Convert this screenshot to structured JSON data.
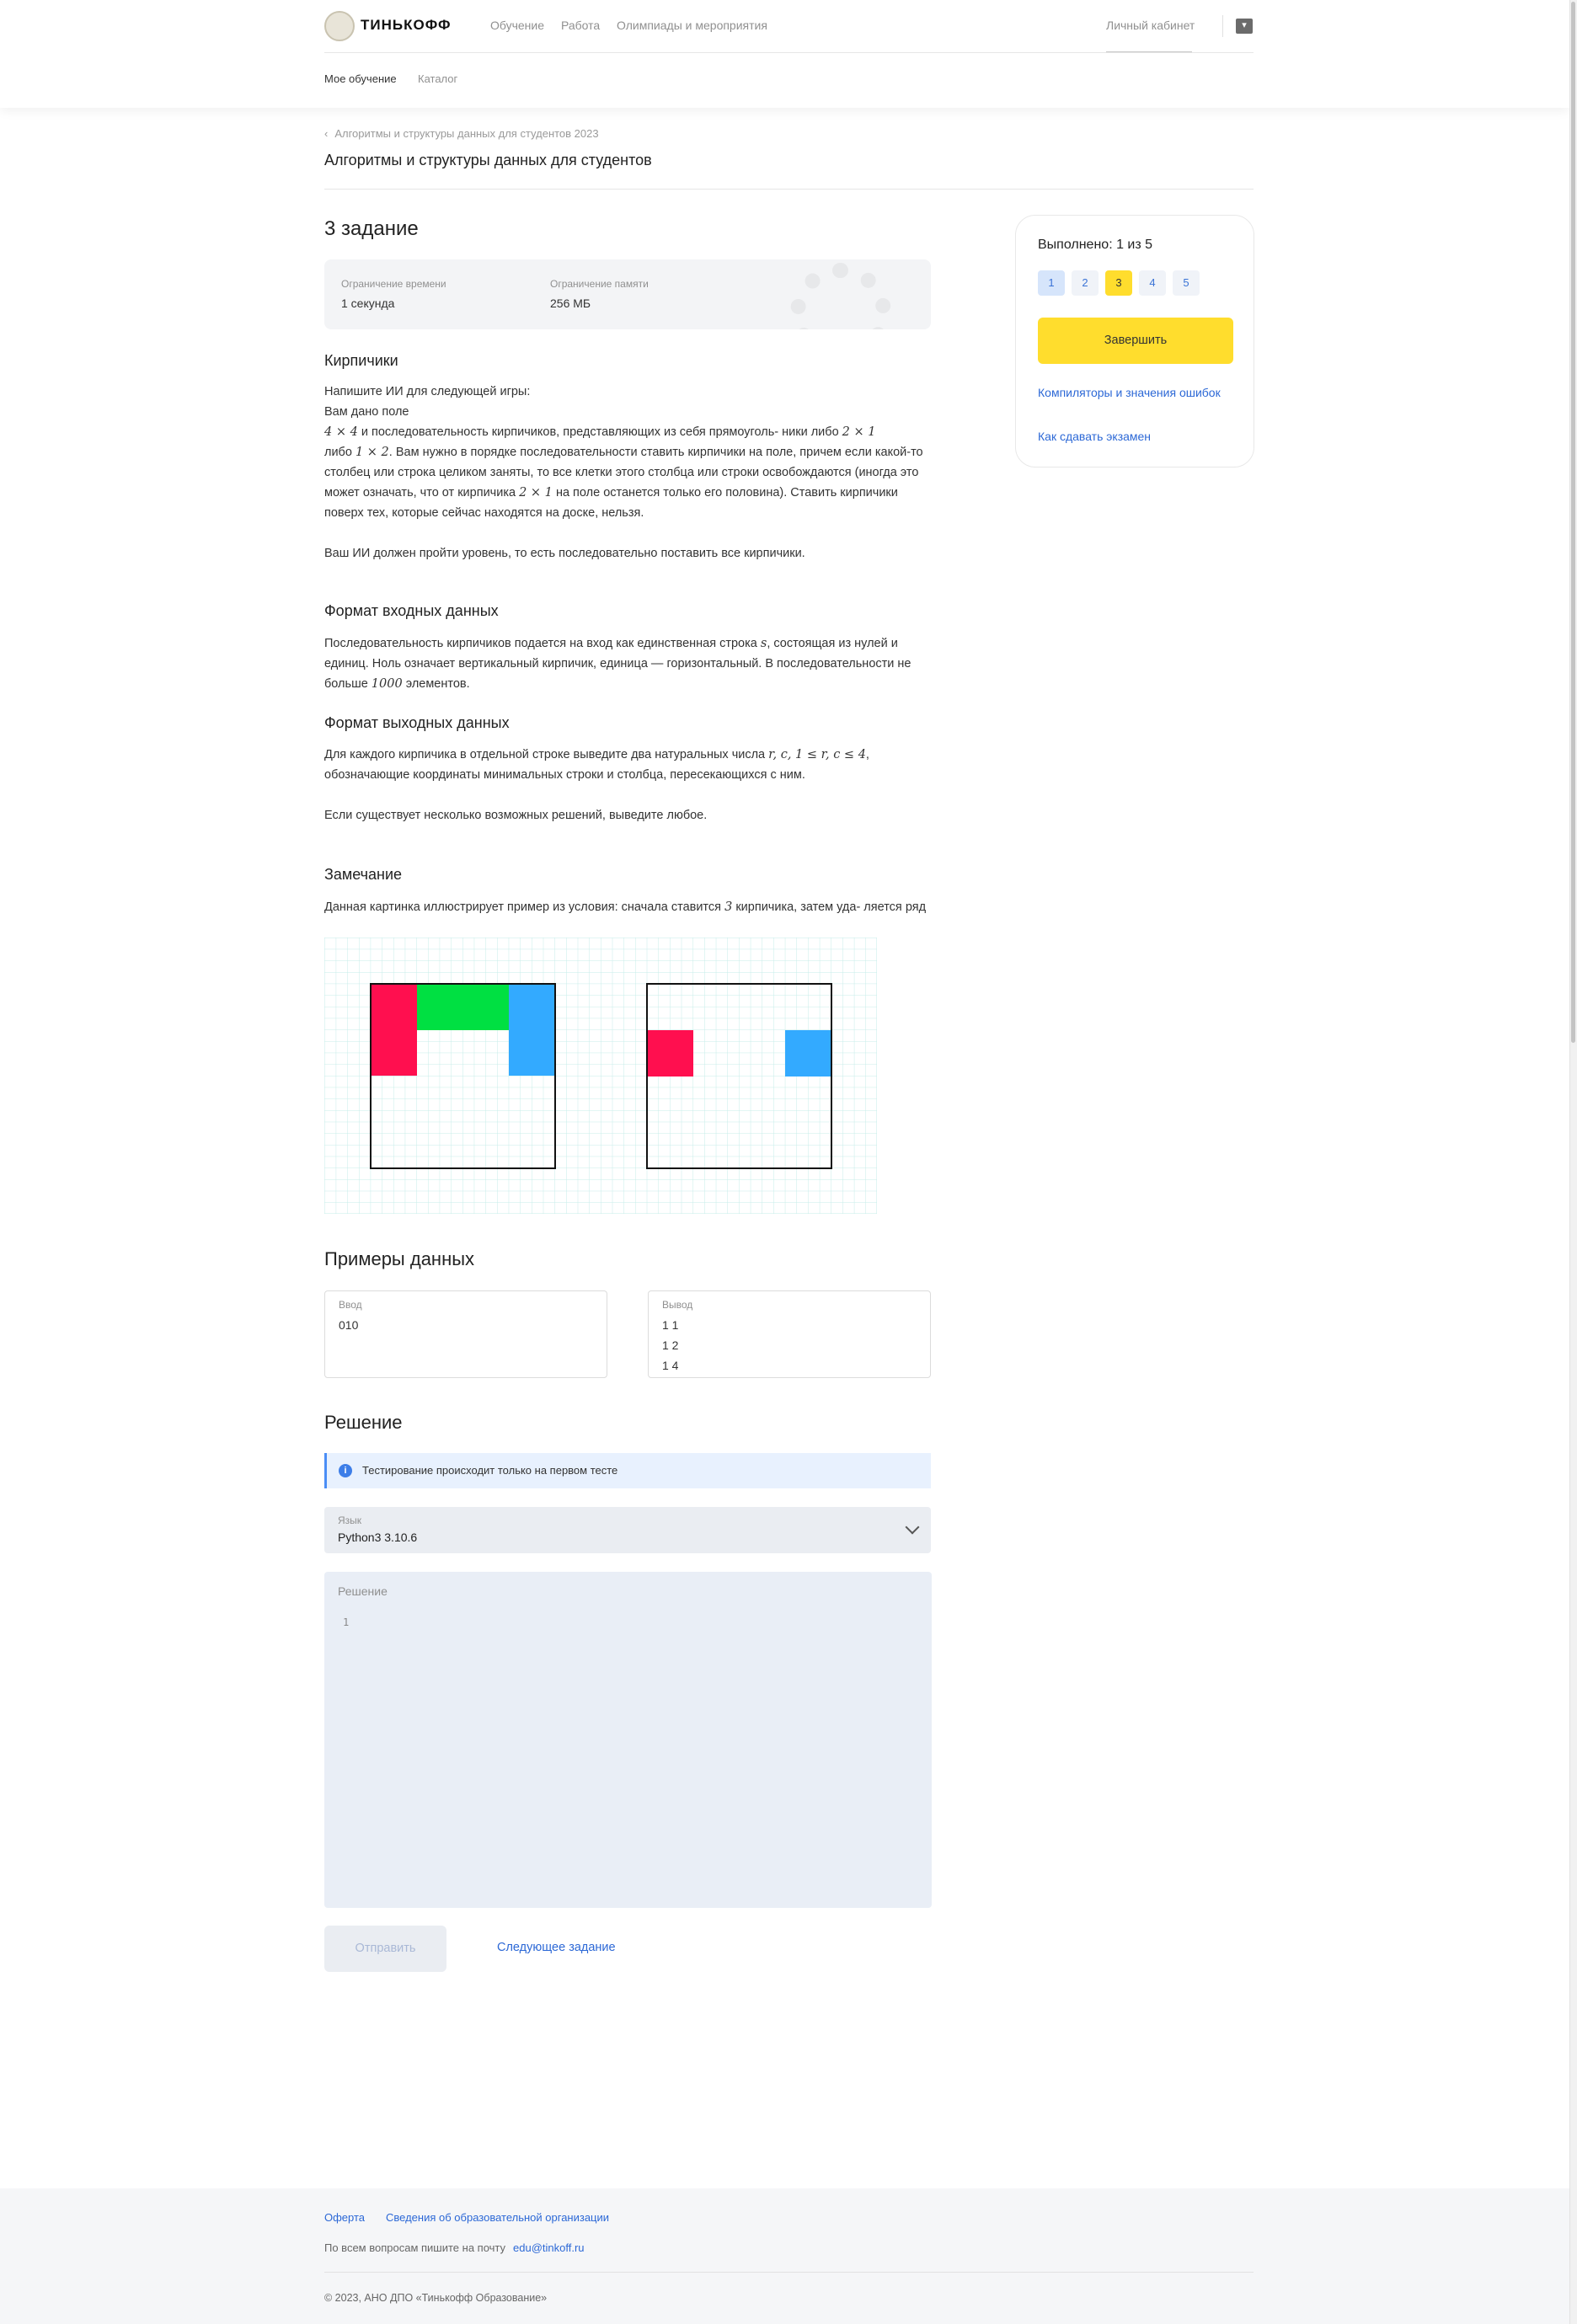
{
  "header": {
    "logo_text": "ТИНЬКОФФ",
    "nav": [
      "Обучение",
      "Работа",
      "Олимпиады и мероприятия"
    ],
    "cabinet": "Личный кабинет",
    "subnav": [
      "Мое обучение",
      "Каталог"
    ]
  },
  "breadcrumb": "Алгоритмы и структуры данных для студентов 2023",
  "course_title": "Алгоритмы и структуры данных для студентов",
  "task": {
    "title": "3 задание",
    "time_label": "Ограничение времени",
    "time_value": "1 секунда",
    "memory_label": "Ограничение памяти",
    "memory_value": "256 МБ",
    "name": "Кирпичики",
    "statement": [
      "Напишите ИИ для следующей игры:",
      "Вам дано поле",
      "и последовательность кирпичиков, представляющих из себя прямоуголь- ники либо",
      "либо",
      ". Вам нужно в порядке последовательности ставить кирпичики на поле, причем если какой-то столбец или строка целиком заняты, то все клетки этого столбца или строки освобождаются (иногда это может означать, что от кирпичика",
      "на поле останется только его половина). Ставить кирпичики поверх тех, которые сейчас находятся на доске, нельзя.",
      "Ваш ИИ должен пройти уровень, то есть последовательно поставить все кирпичики."
    ],
    "math": {
      "m4x4": "4 × 4",
      "m2x1": "2 × 1",
      "m1x2": "1 × 2"
    },
    "input_title": "Формат входных данных",
    "input_text": [
      "Последовательность кирпичиков подается на вход как единственная строка",
      ", состоящая из нулей и единиц. Ноль означает вертикальный кирпичик, единица — горизонтальный. В последовательности не больше",
      "элементов."
    ],
    "input_math": [
      "s",
      "1000"
    ],
    "output_title": "Формат выходных данных",
    "output_text": [
      "Для каждого кирпичика в отдельной строке выведите два натуральных числа",
      ", обозначающие координаты минимальных строки и столбца, пересекающихся с ним.",
      "Если существует несколько возможных решений, выведите любое."
    ],
    "output_math": "r, c, 1 ≤ r, c ≤ 4",
    "note_title": "Замечание",
    "note_text": [
      "Данная картинка иллюстрирует пример из условия: сначала ставится",
      "кирпичика, затем уда- ляется ряд"
    ],
    "note_math": "3"
  },
  "figure": {
    "colors": {
      "red": "#ff0f4f",
      "green": "#00e042",
      "blue": "#33aaff",
      "grid": "#c6ece9"
    }
  },
  "examples": {
    "title": "Примеры данных",
    "input_label": "Ввод",
    "input_lines": [
      "010"
    ],
    "output_label": "Вывод",
    "output_lines": [
      "1 1",
      "1 2",
      "1 4"
    ]
  },
  "solution": {
    "title": "Решение",
    "info": "Тестирование происходит только на первом тесте",
    "lang_label": "Язык",
    "lang_value": "Python3 3.10.6",
    "editor_label": "Решение",
    "line_number": "1",
    "send": "Отправить",
    "next": "Следующее задание"
  },
  "card": {
    "progress": "Выполнено: 1 из 5",
    "tasks": [
      "1",
      "2",
      "3",
      "4",
      "5"
    ],
    "finish": "Завершить",
    "link1": "Компиляторы и значения ошибок",
    "link2": "Как сдавать экзамен"
  },
  "footer": {
    "link1": "Оферта",
    "link2": "Сведения об образовательной организации",
    "contact": "По всем вопросам пишите на почту",
    "email": "edu@tinkoff.ru",
    "copyright": "© 2023, АНО ДПО «Тинькофф Образование»"
  }
}
